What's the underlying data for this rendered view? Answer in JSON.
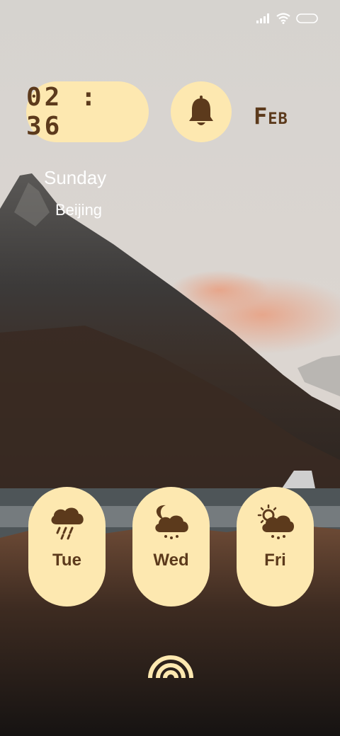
{
  "clock": {
    "time": "02 : 36"
  },
  "date": {
    "month": "Feb",
    "weekday": "Sunday",
    "city": "Beijing"
  },
  "forecast": [
    {
      "day": "Tue",
      "icon": "heavy-rain-cloud-icon"
    },
    {
      "day": "Wed",
      "icon": "night-moon-cloud-icon"
    },
    {
      "day": "Fri",
      "icon": "sun-behind-cloud-icon"
    }
  ],
  "colors": {
    "widget_bg": "#fde8b0",
    "widget_fg": "#5c3a1c",
    "text_light": "#ffffff"
  },
  "status_icons": [
    "signal-icon",
    "wifi-icon",
    "battery-icon"
  ]
}
